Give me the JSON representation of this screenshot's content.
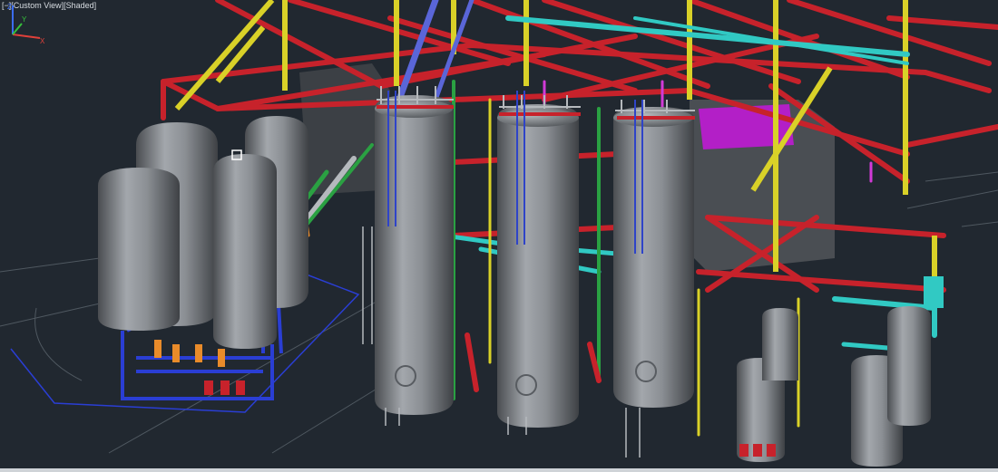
{
  "viewport": {
    "controls": {
      "viewport_menu": "[−]",
      "view_name": "[Custom View]",
      "visual_style": "[Shaded]"
    },
    "background_color": "#212830",
    "ucs": {
      "x_label": "X",
      "y_label": "Y",
      "z_label": "Z"
    },
    "model": {
      "description_icons": [
        "steel-frame",
        "vertical-tank",
        "horizontal-vessel",
        "pipe-rack",
        "ladder",
        "valve-skid"
      ],
      "colors": {
        "steel_red": "#c7222b",
        "steel_yellow": "#d9d128",
        "pipe_cyan": "#31c9c3",
        "pipe_blue": "#2a3ed4",
        "pipe_green": "#2aa142",
        "pipe_orange": "#e98b2a",
        "pipe_magenta": "#d23ad7",
        "tank_gray": "#7d8186"
      }
    }
  }
}
